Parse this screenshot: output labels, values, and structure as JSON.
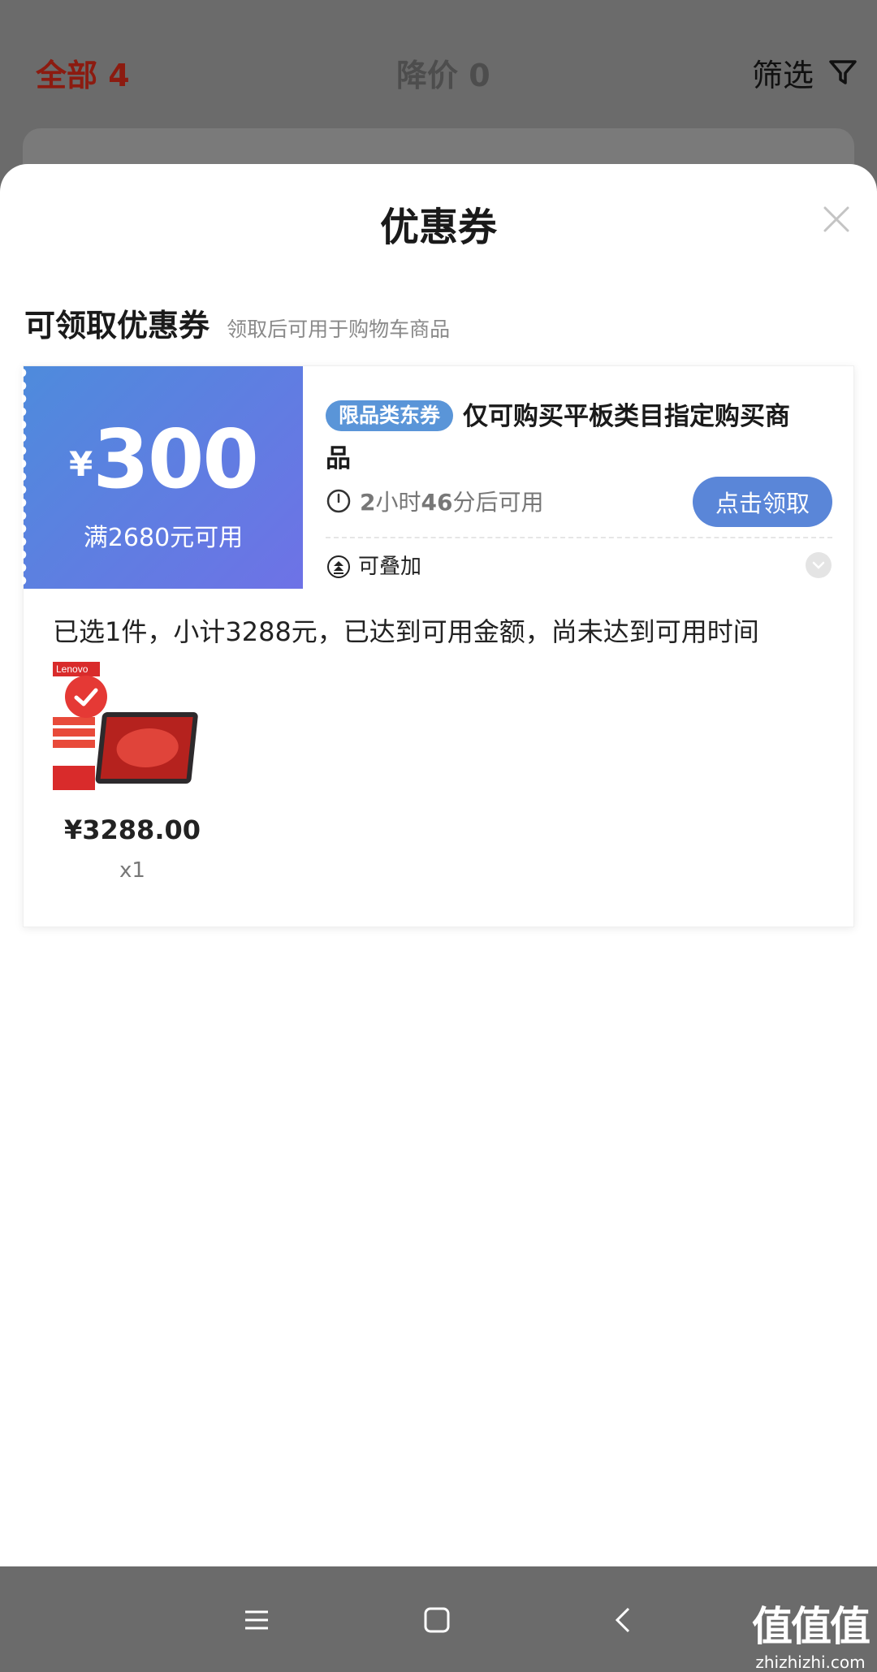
{
  "tabs": {
    "all": "全部 4",
    "price_drop": "降价 0",
    "filter": "筛选"
  },
  "sheet": {
    "title": "优惠券",
    "section_title": "可领取优惠券",
    "section_subtitle": "领取后可用于购物车商品"
  },
  "coupon": {
    "currency": "¥",
    "amount": "300",
    "condition": "满2680元可用",
    "tag": "限品类东券",
    "description": "仅可购买平板类目指定购买商品",
    "time_hours": "2",
    "time_hours_unit": "小时",
    "time_minutes": "46",
    "time_suffix": "分后可用",
    "claim_button": "点击领取",
    "stackable": "可叠加",
    "brand_color": "#5a86d8"
  },
  "selection": {
    "status": "已选1件，小计3288元，已达到可用金额，尚未达到可用时间"
  },
  "product": {
    "price": "¥3288.00",
    "quantity": "x1",
    "brand": "Lenovo"
  },
  "watermark": {
    "main": "值值值",
    "domain": "zhizhizhi.com"
  }
}
